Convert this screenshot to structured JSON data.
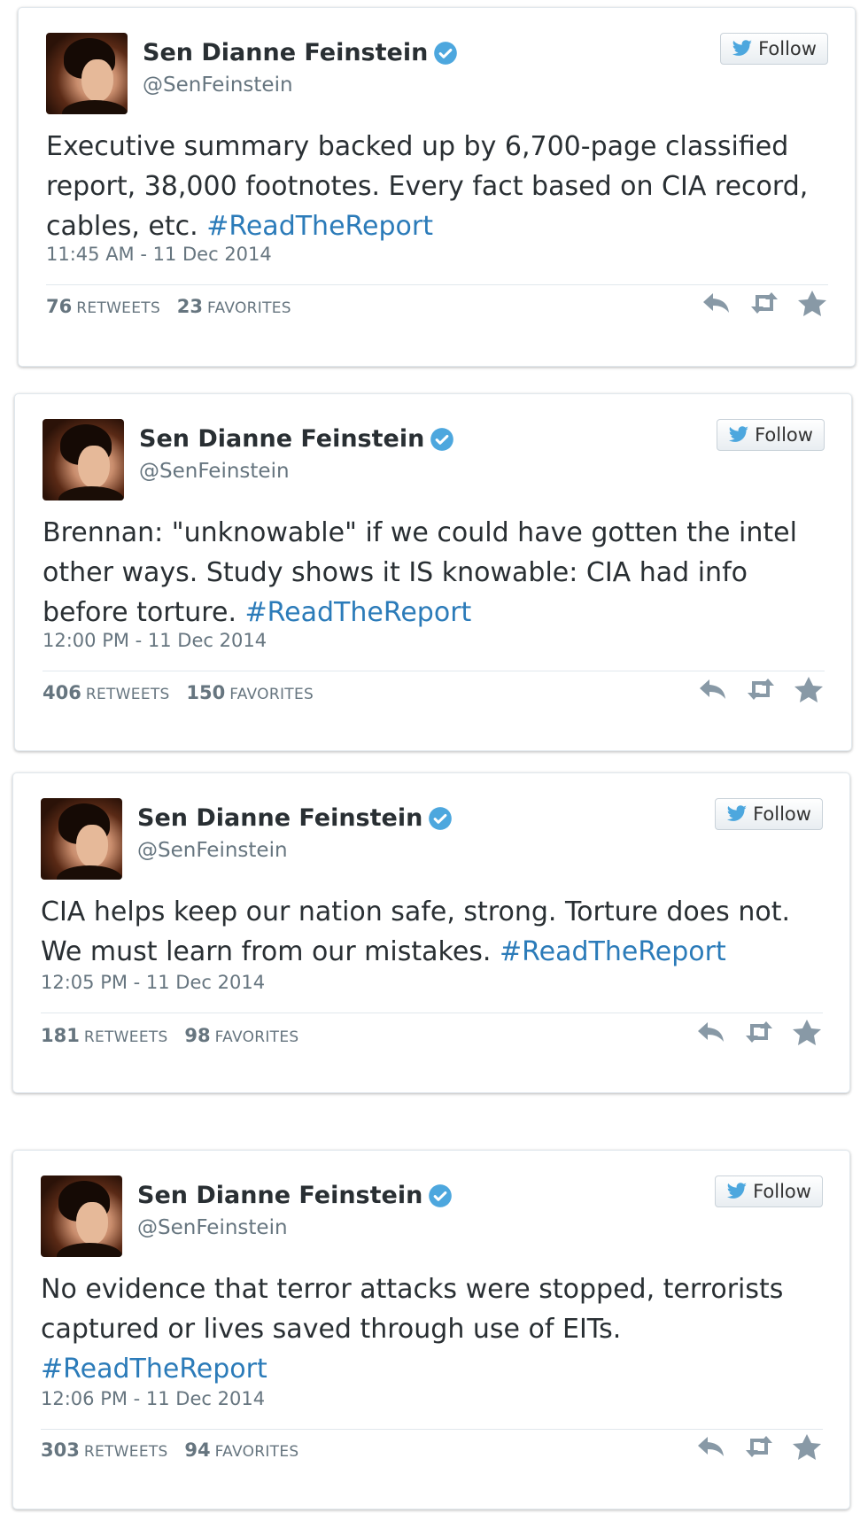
{
  "colors": {
    "hashtag": "#2b7bb9",
    "verified": "#4da7de",
    "text": "#292f33",
    "muted": "#66757f"
  },
  "follow_label": "Follow",
  "tweets": [
    {
      "name": "Sen Dianne Feinstein",
      "handle": "@SenFeinstein",
      "text": "Executive summary backed up by 6,700-page classified report, 38,000 footnotes. Every fact based on CIA record, cables, etc.",
      "hashtag": "#ReadTheReport",
      "timestamp": "11:45 AM - 11 Dec 2014",
      "retweets": "76",
      "retweets_label": "RETWEETS",
      "favorites": "23",
      "favorites_label": "FAVORITES"
    },
    {
      "name": "Sen Dianne Feinstein",
      "handle": "@SenFeinstein",
      "text": "Brennan: \"unknowable\" if we could have gotten the intel other ways. Study shows it IS knowable: CIA had info before torture.",
      "hashtag": "#ReadTheReport",
      "timestamp": "12:00 PM - 11 Dec 2014",
      "retweets": "406",
      "retweets_label": "RETWEETS",
      "favorites": "150",
      "favorites_label": "FAVORITES"
    },
    {
      "name": "Sen Dianne Feinstein",
      "handle": "@SenFeinstein",
      "text": "CIA helps keep our nation safe, strong. Torture does not. We must learn from our mistakes.",
      "hashtag": "#ReadTheReport",
      "timestamp": "12:05 PM - 11 Dec 2014",
      "retweets": "181",
      "retweets_label": "RETWEETS",
      "favorites": "98",
      "favorites_label": "FAVORITES"
    },
    {
      "name": "Sen Dianne Feinstein",
      "handle": "@SenFeinstein",
      "text": "No evidence that terror attacks were stopped, terrorists captured or lives saved through use of EITs.",
      "hashtag": "#ReadTheReport",
      "timestamp": "12:06 PM - 11 Dec 2014",
      "retweets": "303",
      "retweets_label": "RETWEETS",
      "favorites": "94",
      "favorites_label": "FAVORITES"
    }
  ]
}
